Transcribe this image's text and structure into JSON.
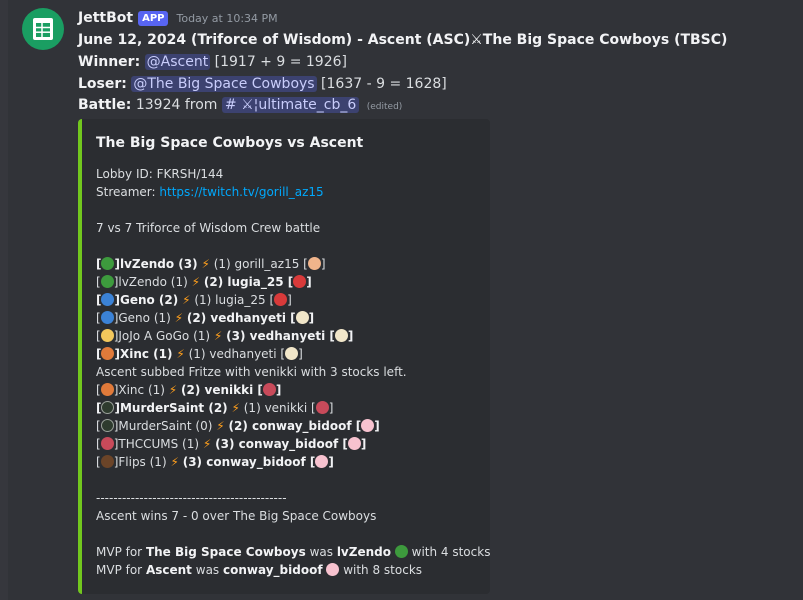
{
  "message": {
    "author": "JettBot",
    "badge": "APP",
    "timestamp": "Today at 10:34 PM",
    "title_line": "June 12, 2024 (Triforce of Wisdom) - Ascent (ASC)⚔The Big Space Cowboys (TBSC)",
    "winner_label": "Winner:",
    "winner_mention": "@Ascent",
    "winner_rating": "[1917 + 9 = 1926]",
    "loser_label": "Loser:",
    "loser_mention": "@The Big Space Cowboys",
    "loser_rating": "[1637 - 9 = 1628]",
    "battle_label": "Battle:",
    "battle_text": "13924 from",
    "battle_channel": "# ⚔¦ultimate_cb_6",
    "edited": "(edited)"
  },
  "embed": {
    "accent_color": "#72c71e",
    "title": "The Big Space Cowboys vs Ascent",
    "lobby": "Lobby ID: FKRSH/144",
    "streamer_label": "Streamer:",
    "streamer_link": "https://twitch.tv/gorill_az15",
    "battle_desc": "7 vs 7 Triforce of Wisdom Crew battle",
    "rows": [
      {
        "pre": "[",
        "p1": "]lvZendo (3)",
        "mid": "(1) gorill_az15 [",
        "end": "]"
      },
      {
        "pre": "[",
        "p1": "]lvZendo (1)",
        "mid": "(2) lugia_25 [",
        "end": "]"
      },
      {
        "pre": "[",
        "p1": "]Geno (2)",
        "mid": "(1) lugia_25 [",
        "end": "]"
      },
      {
        "pre": "[",
        "p1": "]Geno (1)",
        "mid": "(2) vedhanyeti [",
        "end": "]"
      },
      {
        "pre": "[",
        "p1": "]JoJo A GoGo (1)",
        "mid": "(3) vedhanyeti [",
        "end": "]"
      },
      {
        "pre": "[",
        "p1": "]Xinc (1)",
        "mid": "(1) vedhanyeti [",
        "end": "]"
      },
      {
        "text": "Ascent subbed Fritze with venikki with 3 stocks left."
      },
      {
        "pre": "[",
        "p1": "]Xinc (1)",
        "mid": "(2) venikki [",
        "end": "]"
      },
      {
        "pre": "[",
        "p1": "]MurderSaint (2)",
        "mid": "(1) venikki [",
        "end": "]"
      },
      {
        "pre": "[",
        "p1": "]MurderSaint (0)",
        "mid": "(2) conway_bidoof [",
        "end": "]"
      },
      {
        "pre": "[",
        "p1": "]THCCUMS (1)",
        "mid": "(3) conway_bidoof [",
        "end": "]"
      },
      {
        "pre": "[",
        "p1": "]Flips (1)",
        "mid": "(3) conway_bidoof [",
        "end": "]"
      }
    ],
    "divider": "--------------------------------------------",
    "result": "Ascent wins 7 - 0 over The Big Space Cowboys",
    "mvp1_pre": "MVP for",
    "mvp1_team": "The Big Space Cowboys",
    "mvp1_was": "was",
    "mvp1_player": "lvZendo",
    "mvp1_post": "with 4 stocks",
    "mvp2_pre": "MVP for",
    "mvp2_team": "Ascent",
    "mvp2_was": "was",
    "mvp2_player": "conway_bidoof",
    "mvp2_post": "with 8 stocks"
  }
}
